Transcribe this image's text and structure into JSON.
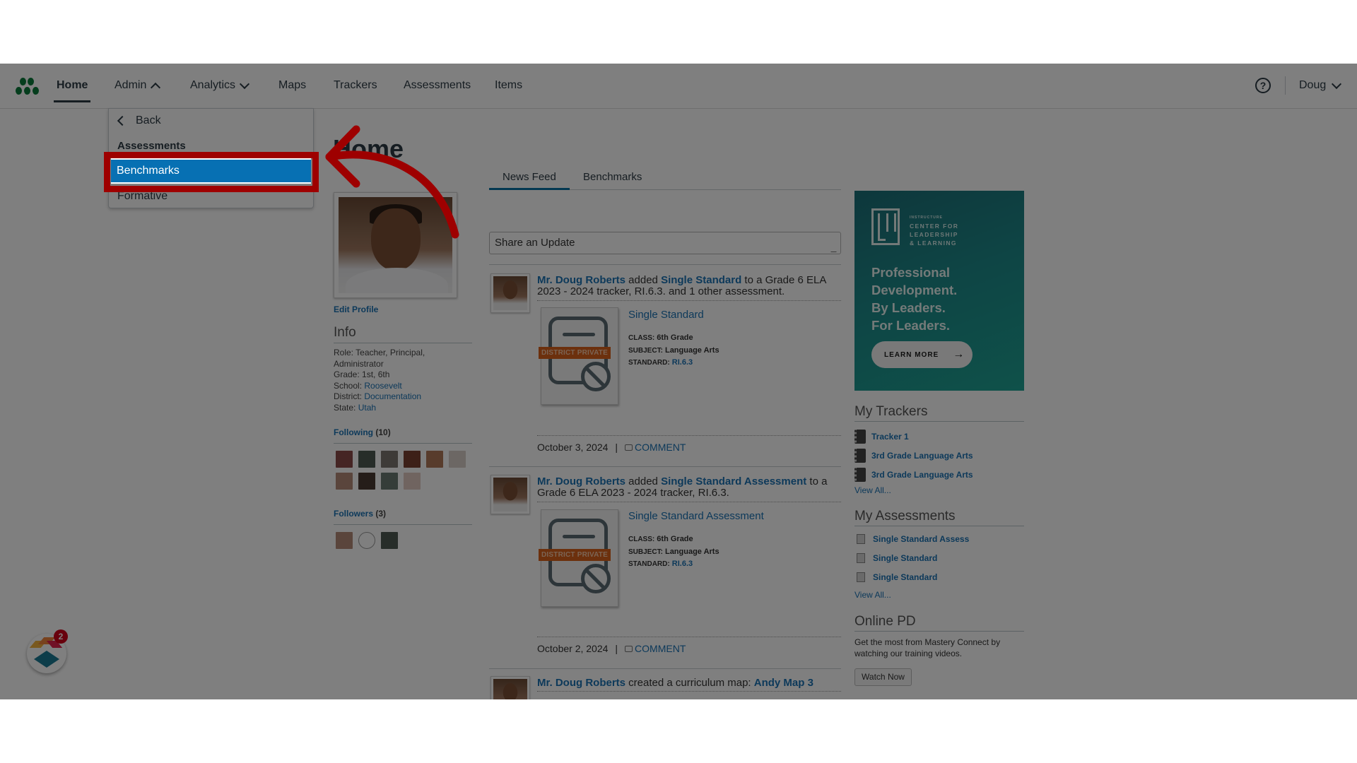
{
  "nav": {
    "logo_icon": "mastery-connect-logo",
    "items": [
      {
        "label": "Home",
        "active": true
      },
      {
        "label": "Admin",
        "chevron": "up"
      },
      {
        "label": "Analytics",
        "chevron": "down"
      },
      {
        "label": "Maps"
      },
      {
        "label": "Trackers"
      },
      {
        "label": "Assessments"
      },
      {
        "label": "Items"
      }
    ],
    "help_icon": "?",
    "user": "Doug"
  },
  "admin_menu": {
    "back_label": "Back",
    "section_heading": "Assessments",
    "items": [
      {
        "label": "Benchmarks",
        "highlighted": true
      },
      {
        "label": "Formative"
      }
    ]
  },
  "page": {
    "title": "Home"
  },
  "profile": {
    "edit_profile": "Edit Profile",
    "info_heading": "Info",
    "role_label": "Role:",
    "role": "Teacher, Principal, Administrator",
    "grade_label": "Grade:",
    "grade": "1st, 6th",
    "school_label": "School:",
    "school": "Roosevelt",
    "district_label": "District:",
    "district": "Documentation",
    "state_label": "State:",
    "state": "Utah",
    "following_label": "Following",
    "following_count": "(10)",
    "followers_label": "Followers",
    "followers_count": "(3)"
  },
  "feed": {
    "tabs": [
      {
        "label": "News Feed",
        "active": true
      },
      {
        "label": "Benchmarks"
      }
    ],
    "share_placeholder": "Share an Update",
    "posts": [
      {
        "author": "Mr. Doug Roberts",
        "verb": " added ",
        "object": "Single Standard",
        "rest": " to a Grade 6 ELA 2023 - 2024 tracker, RI.6.3. and 1 other assessment.",
        "card": {
          "badge": "DISTRICT PRIVATE",
          "title": "Single Standard",
          "class_label": "Class:",
          "class": "6th Grade",
          "subject_label": "Subject:",
          "subject": "Language Arts",
          "standard_label": "Standard:",
          "standard": "RI.6.3"
        },
        "date": "October 3, 2024",
        "separator": "|",
        "comment": "COMMENT"
      },
      {
        "author": "Mr. Doug Roberts",
        "verb": " added ",
        "object": "Single Standard Assessment",
        "rest": " to a Grade 6 ELA 2023 - 2024 tracker, RI.6.3.",
        "card": {
          "badge": "DISTRICT PRIVATE",
          "title": "Single Standard Assessment",
          "class_label": "Class:",
          "class": "6th Grade",
          "subject_label": "Subject:",
          "subject": "Language Arts",
          "standard_label": "Standard:",
          "standard": "RI.6.3"
        },
        "date": "October 2, 2024",
        "separator": "|",
        "comment": "COMMENT"
      },
      {
        "author": "Mr. Doug Roberts",
        "verb": " created a curriculum map: ",
        "object": "Andy Map 3"
      }
    ]
  },
  "ad": {
    "brand_small": "INSTRUCTURE",
    "brand_line1": "CENTER FOR",
    "brand_line2": "LEADERSHIP",
    "brand_line3": "& LEARNING",
    "headline1": "Professional",
    "headline2": "Development.",
    "headline3": "By Leaders.",
    "headline4": "For Leaders.",
    "button": "LEARN MORE",
    "button_arrow": "→"
  },
  "trackers": {
    "heading": "My Trackers",
    "items": [
      "Tracker 1",
      "3rd Grade Language Arts",
      "3rd Grade Language Arts"
    ],
    "view_all": "View All..."
  },
  "assessments": {
    "heading": "My Assessments",
    "items": [
      "Single Standard Assess",
      "Single Standard",
      "Single Standard"
    ],
    "view_all": "View All..."
  },
  "online_pd": {
    "heading": "Online PD",
    "text": "Get the most from Mastery Connect by watching our training videos.",
    "button": "Watch Now"
  },
  "widget": {
    "badge_count": "2"
  },
  "annotation": {
    "color": "#9e0000",
    "target": "Benchmarks"
  },
  "colors": {
    "link": "#1a73b5",
    "highlight": "#0770b3",
    "badge": "#d9611b",
    "logo": "#0a7a3a"
  }
}
